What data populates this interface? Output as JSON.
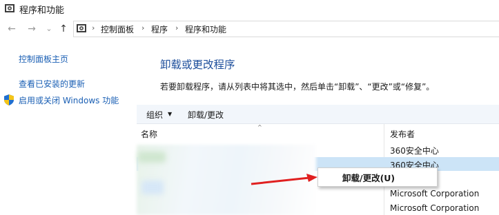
{
  "window": {
    "title": "程序和功能"
  },
  "address_bar": {
    "breadcrumbs": [
      "控制面板",
      "程序",
      "程序和功能"
    ],
    "separator": "›"
  },
  "nav": {
    "back": "←",
    "forward": "→",
    "dropdown": "⌄",
    "up": "↑"
  },
  "left_pane": {
    "home_link": "控制面板主页",
    "installed_updates_link": "查看已安装的更新",
    "features_link": "启用或关闭 Windows 功能"
  },
  "main": {
    "heading": "卸载或更改程序",
    "description": "若要卸载程序，请从列表中将其选中，然后单击“卸载”、“更改”或“修复”。"
  },
  "toolbar": {
    "organize": "组织",
    "organize_caret": "▼",
    "uninstall_change": "卸载/更改"
  },
  "columns": {
    "name": "名称",
    "publisher": "发布者",
    "sort_indicator": "^"
  },
  "rows": [
    {
      "publisher": "360安全中心"
    },
    {
      "publisher": "360安全中心"
    },
    {
      "publisher": ""
    },
    {
      "publisher": "Microsoft Corporation"
    },
    {
      "publisher": "Microsoft Corporation"
    }
  ],
  "context_menu": {
    "item": "卸载/更改(U)"
  },
  "colors": {
    "link_blue": "#1a5fb4",
    "heading_blue": "#1e4f9c",
    "selection": "#cce4f7",
    "annotation_red": "#e02020"
  }
}
